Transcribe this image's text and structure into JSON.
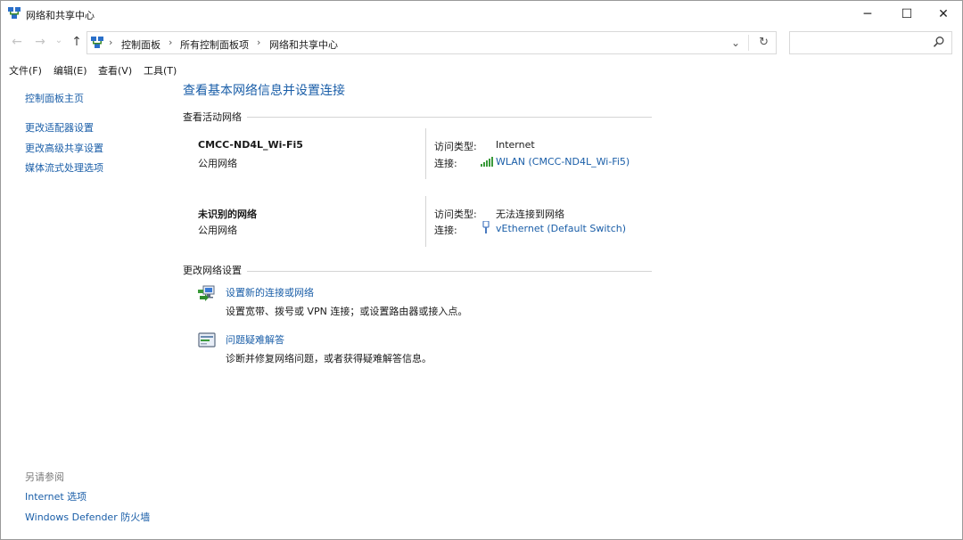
{
  "window": {
    "title": "网络和共享中心"
  },
  "window_controls": {
    "minimize": "─",
    "maximize": "☐",
    "close": "✕"
  },
  "nav": {
    "back": "←",
    "forward": "→",
    "recent": "⌄",
    "up": "↑"
  },
  "address": {
    "crumbs": [
      "控制面板",
      "所有控制面板项",
      "网络和共享中心"
    ],
    "separator": "›",
    "dropdown": "⌄",
    "refresh": "↻"
  },
  "search": {
    "placeholder": ""
  },
  "menu": [
    "文件(F)",
    "编辑(E)",
    "查看(V)",
    "工具(T)"
  ],
  "sidebar": {
    "home": "控制面板主页",
    "links": [
      "更改适配器设置",
      "更改高级共享设置",
      "媒体流式处理选项"
    ],
    "see_also_title": "另请参阅",
    "see_also": [
      "Internet 选项",
      "Windows Defender 防火墙"
    ]
  },
  "main": {
    "title": "查看基本网络信息并设置连接",
    "active_networks_header": "查看活动网络",
    "networks": [
      {
        "name": "CMCC-ND4L_Wi-Fi5",
        "category": "公用网络",
        "access_label": "访问类型:",
        "access_value": "Internet",
        "connection_label": "连接:",
        "connection_value": "WLAN (CMCC-ND4L_Wi-Fi5)",
        "connection_icon": "wifi-signal-icon"
      },
      {
        "name": "未识别的网络",
        "category": "公用网络",
        "access_label": "访问类型:",
        "access_value": "无法连接到网络",
        "connection_label": "连接:",
        "connection_value": "vEthernet (Default Switch)",
        "connection_icon": "ethernet-plug-icon"
      }
    ],
    "change_settings_header": "更改网络设置",
    "tasks": [
      {
        "title": "设置新的连接或网络",
        "desc": "设置宽带、拨号或 VPN 连接；或设置路由器或接入点。",
        "icon": "new-connection-icon"
      },
      {
        "title": "问题疑难解答",
        "desc": "诊断并修复网络问题，或者获得疑难解答信息。",
        "icon": "troubleshoot-icon"
      }
    ]
  },
  "colors": {
    "link": "#1a5ea8",
    "divider": "#d4d4d4",
    "muted": "#7a7a7a"
  }
}
